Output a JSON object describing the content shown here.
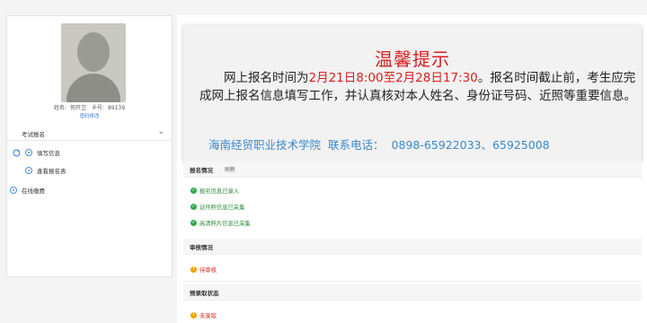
{
  "user": {
    "name_label": "姓名:",
    "name": "何开卫",
    "card_label": "卡号:",
    "card": "89139",
    "password_link": "密码修改"
  },
  "sidebar": {
    "menu_head": "考试报名",
    "items": [
      {
        "label": "填写信息"
      },
      {
        "label": "查看报名表"
      },
      {
        "label": "在线缴费"
      }
    ]
  },
  "notice": {
    "title": "温馨提示",
    "body_prefix": "网上报名时间为",
    "body_date": "2月21日8:00至2月28日17:30",
    "body_suffix": "。报名时间截止前，考生应完成网上报名信息填写工作，并认真核对本人姓名、身份证号码、近照等重要信息。",
    "school": "海南经贸职业技术学院",
    "contact_label": "联系电话：",
    "phones": "0898-65922033、65925008"
  },
  "sections": {
    "registration": {
      "title": "报名情况",
      "refresh": "刷新"
    },
    "review": {
      "title": "审核情况"
    },
    "admit": {
      "title": "预录取状态"
    }
  },
  "statuses": {
    "reg": [
      "报名信息已录入",
      "证件照信息已采集",
      "高清照片信息已采集"
    ],
    "review": "待审核",
    "admit": "未录取"
  },
  "colors": {
    "accent_red": "#d81e1e",
    "link_blue": "#3a89c9",
    "ok_green": "#33a94c",
    "warn_orange": "#f0a000"
  }
}
